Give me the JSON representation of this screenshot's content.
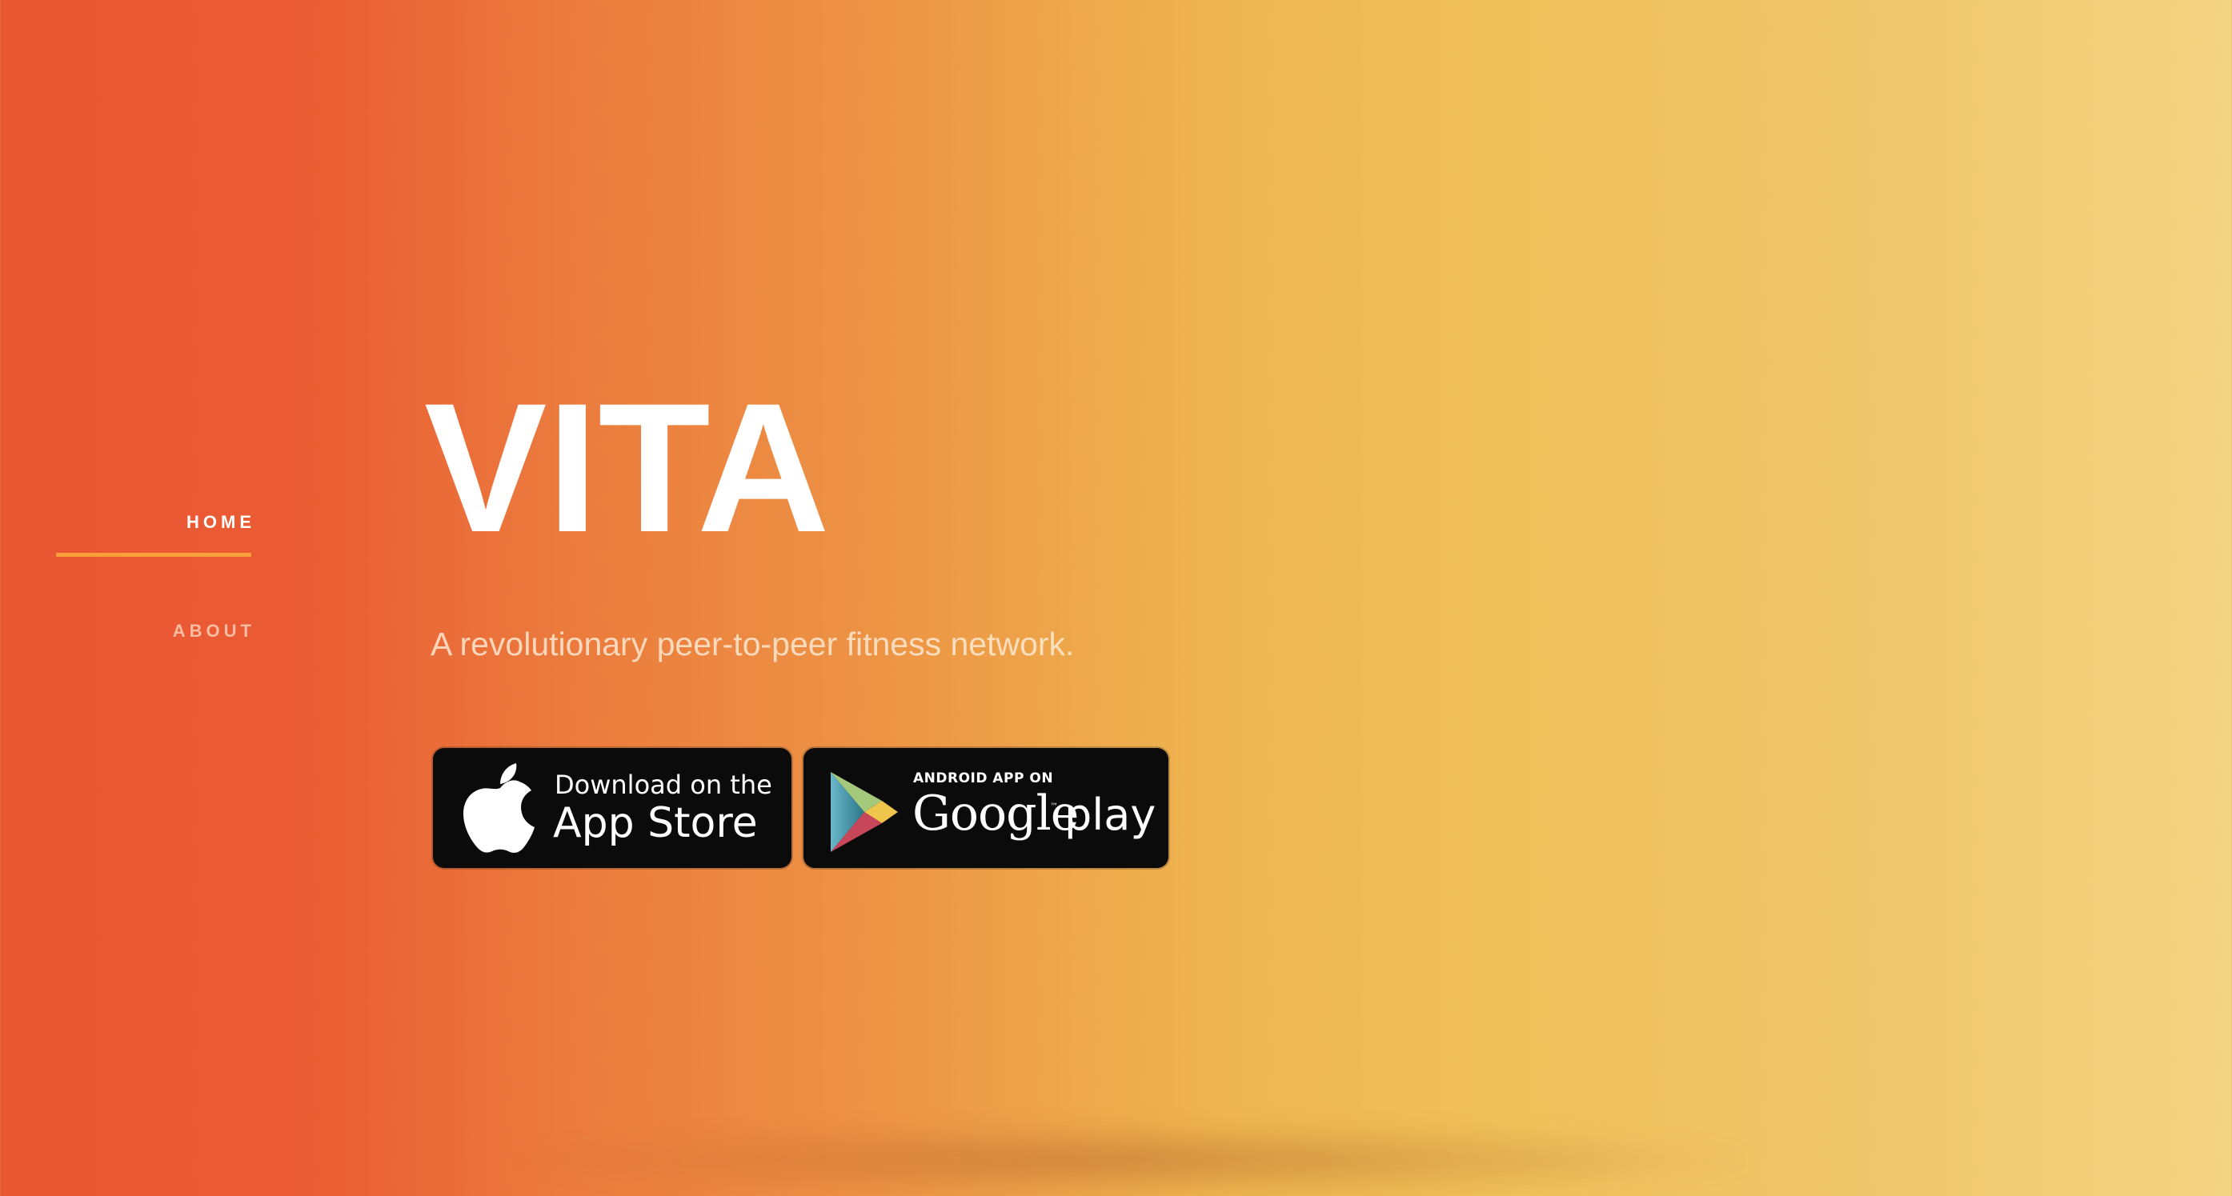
{
  "nav": {
    "items": [
      {
        "label": "HOME",
        "active": true
      },
      {
        "label": "ABOUT",
        "active": false
      }
    ]
  },
  "hero": {
    "title": "VITA",
    "tagline": "A revolutionary peer-to-peer fitness network."
  },
  "badges": {
    "apple": {
      "line1": "Download on the",
      "line2": "App Store"
    },
    "google": {
      "line1": "ANDROID APP ON",
      "wordmark": "Google",
      "tm": "™",
      "line2": "play"
    }
  },
  "icons": {
    "apple": "apple-logo-icon",
    "google_play": "google-play-logo-icon"
  },
  "colors": {
    "gradient_start": "#ea5833",
    "gradient_mid": "#eeb650",
    "gradient_end": "#f3d482",
    "nav_accent": "#f8a13a",
    "badge_bg": "#0b0b0b",
    "text_primary": "#ffffff"
  }
}
